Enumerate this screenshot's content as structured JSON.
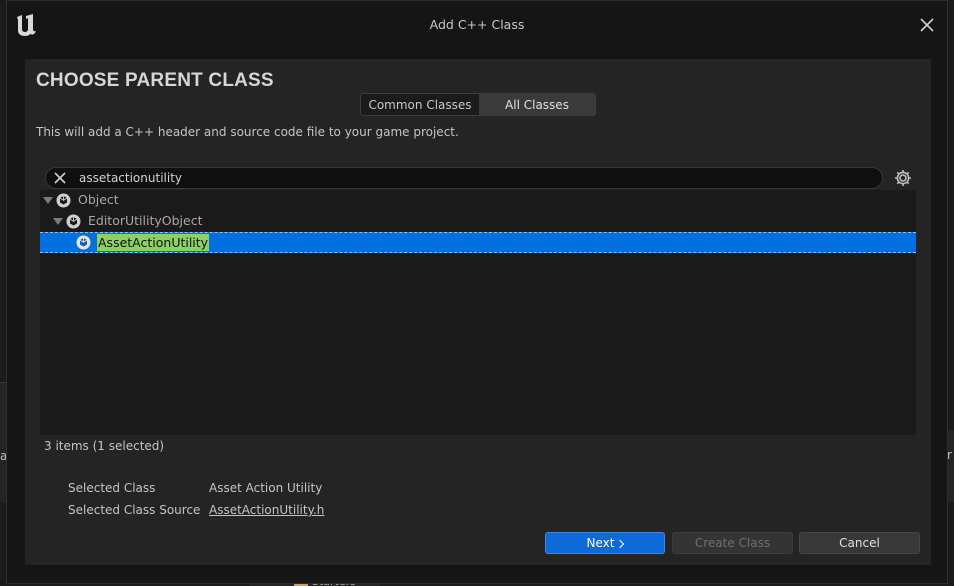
{
  "window": {
    "title": "Add C++ Class"
  },
  "background": {
    "left_fragment": "a",
    "right_fragment": "r",
    "bottom_fragment": "Starters"
  },
  "panel": {
    "heading": "CHOOSE PARENT CLASS",
    "tabs": [
      {
        "label": "Common Classes",
        "active": false
      },
      {
        "label": "All Classes",
        "active": true
      }
    ],
    "description": "This will add a C++ header and source code file to your game project."
  },
  "search": {
    "value": "assetactionutility"
  },
  "tree": {
    "rows": [
      {
        "label": "Object",
        "expanded": true
      },
      {
        "label": "EditorUtilityObject",
        "expanded": true
      },
      {
        "label": "AssetActionUtility",
        "selected": true
      }
    ]
  },
  "status": {
    "count": "3 items (1 selected)"
  },
  "details": {
    "selected_class_label": "Selected Class",
    "selected_class_value": "Asset Action Utility",
    "selected_source_label": "Selected Class Source",
    "selected_source_value": "AssetActionUtility.h"
  },
  "buttons": {
    "next": "Next",
    "create": "Create Class",
    "cancel": "Cancel"
  },
  "colors": {
    "accent": "#0e6ad8",
    "selection": "#0070e0",
    "highlight": "#8bd35c"
  },
  "icons": {
    "logo": "unreal-logo-icon",
    "close": "close-icon",
    "clear": "clear-x-icon",
    "settings": "gear-icon",
    "class": "class-sphere-icon"
  }
}
